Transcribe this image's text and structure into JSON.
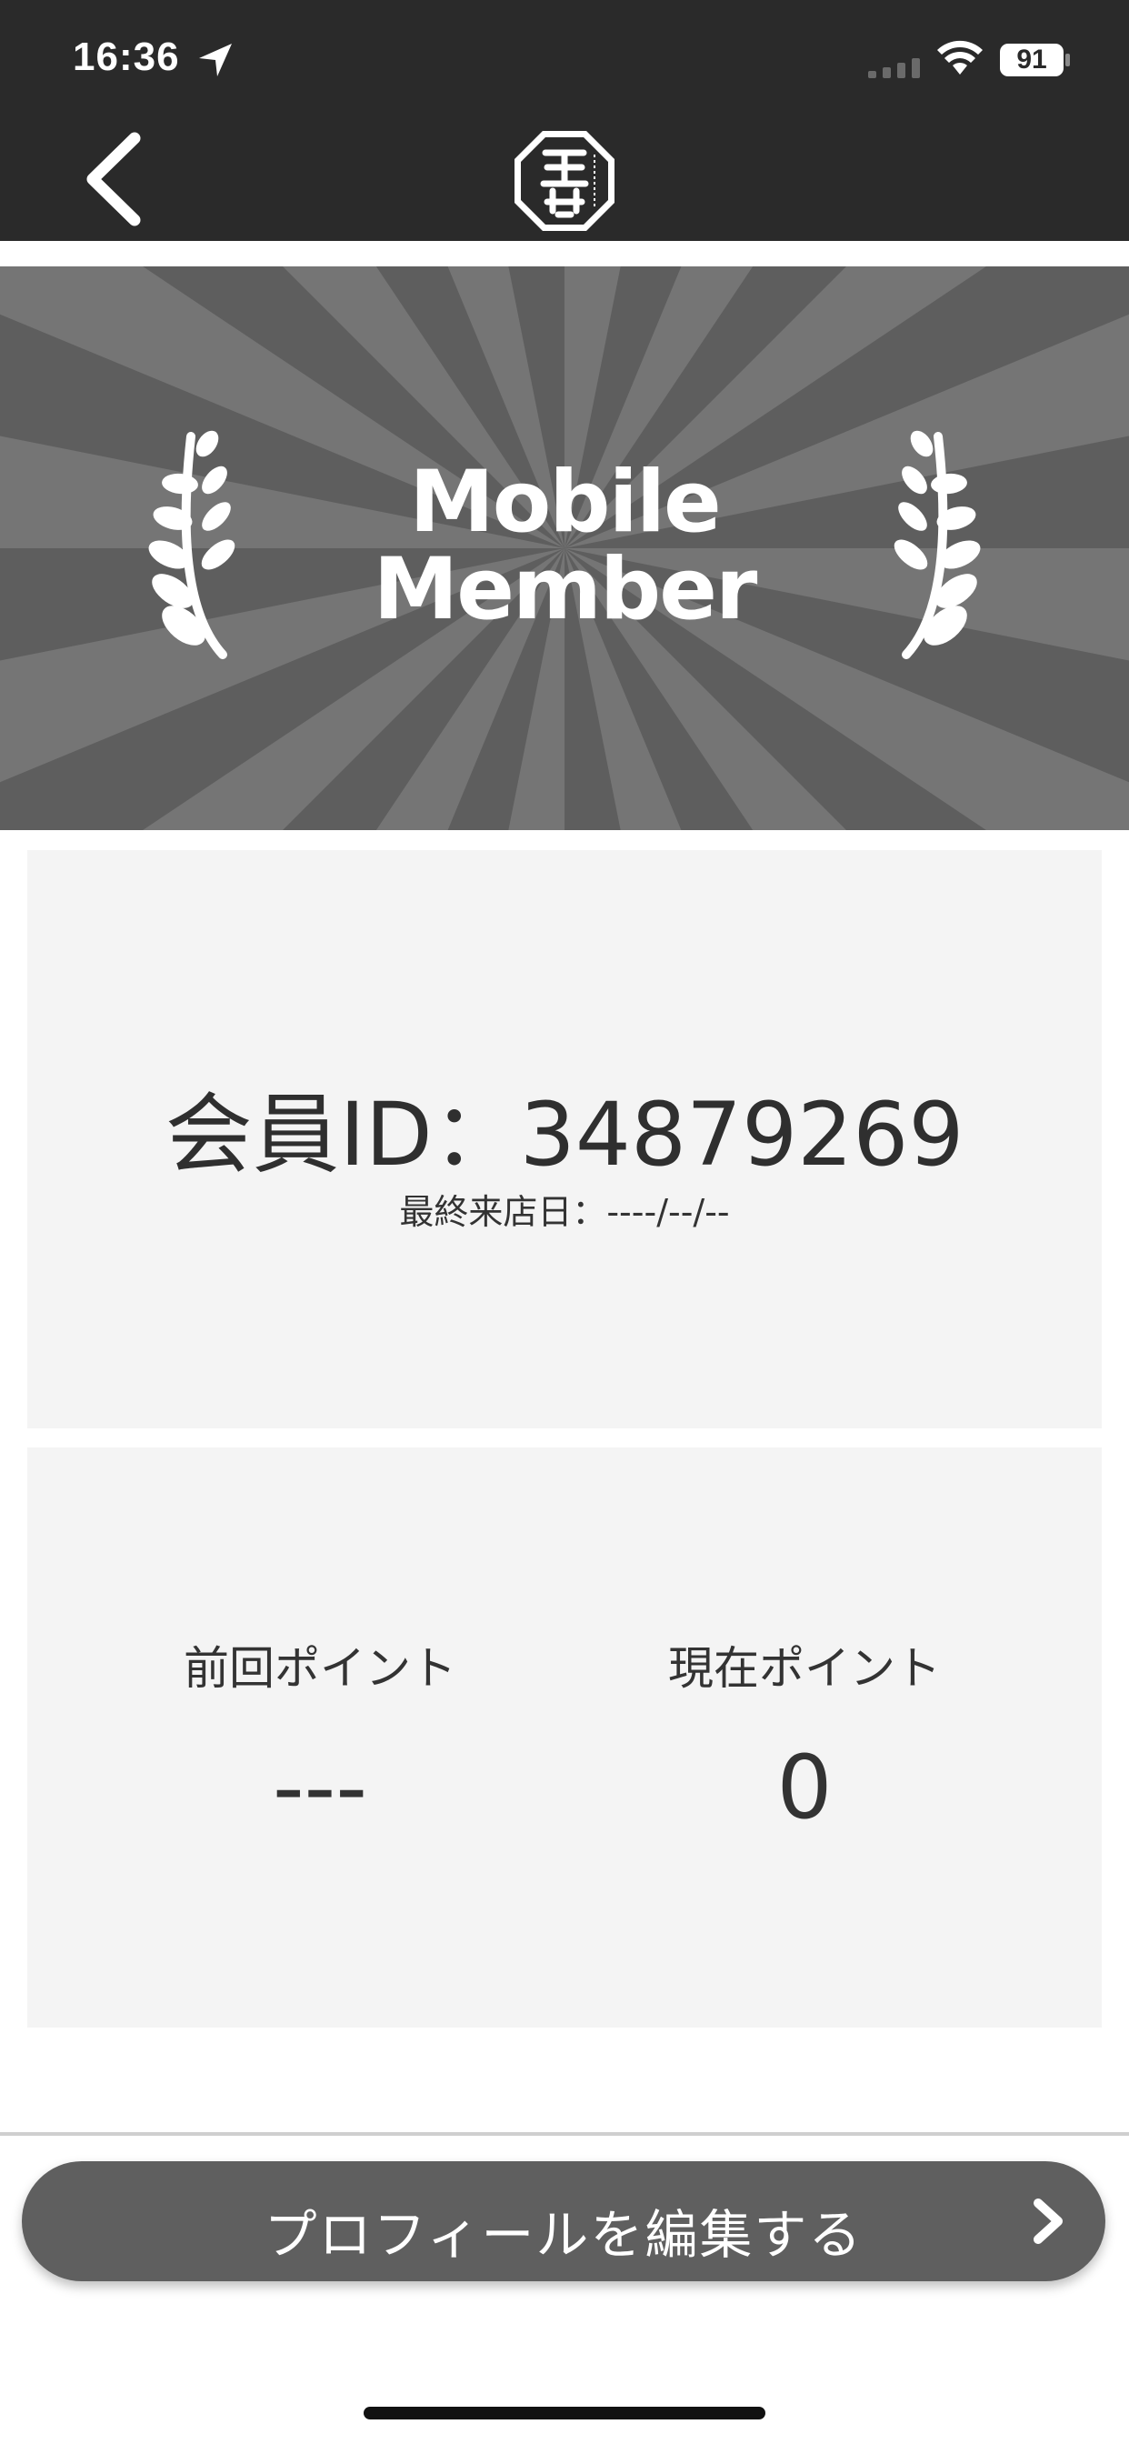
{
  "status": {
    "time": "16:36",
    "battery": "91"
  },
  "nav": {
    "back_icon": "chevron-left-icon",
    "logo_icon": "brand-logo"
  },
  "hero": {
    "title_line1": "Mobile",
    "title_line2": "Member"
  },
  "member": {
    "id_text": "会員ID：34879269",
    "last_visit": "最終来店日：----/--/--"
  },
  "points": {
    "previous_label": "前回ポイント",
    "previous_value": "---",
    "current_label": "現在ポイント",
    "current_value": "0"
  },
  "actions": {
    "edit_profile": "プロフィールを編集する"
  },
  "colors": {
    "dark_bar": "#2a2a2a",
    "hero_bg": "#5e5e5e",
    "panel_bg": "#f4f4f4",
    "button_bg": "#5f5f5f"
  }
}
